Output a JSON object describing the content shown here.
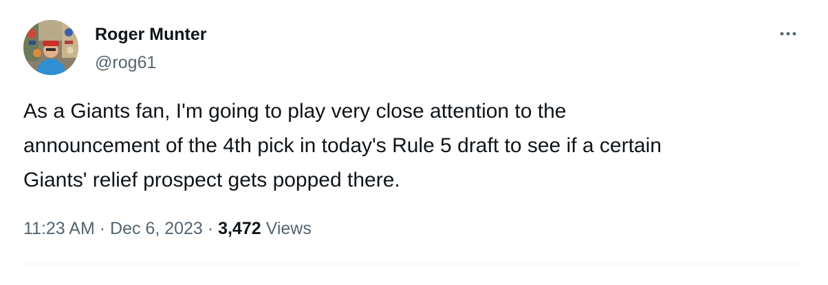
{
  "author": {
    "name": "Roger Munter",
    "handle": "@rog61"
  },
  "more_icon": "more-horizontal-icon",
  "tweet": {
    "lines": [
      "As a Giants fan, I'm going to play very close attention to the",
      "announcement of the 4th pick in today's Rule 5 draft to see if a certain",
      "Giants' relief prospect gets popped there."
    ]
  },
  "meta": {
    "time": "11:23 AM",
    "separator": "·",
    "date": "Dec 6, 2023",
    "views_count": "3,472",
    "views_label": "Views"
  },
  "colors": {
    "primary_text": "#0f1419",
    "secondary_text": "#536471",
    "divider": "#eff3f4"
  }
}
